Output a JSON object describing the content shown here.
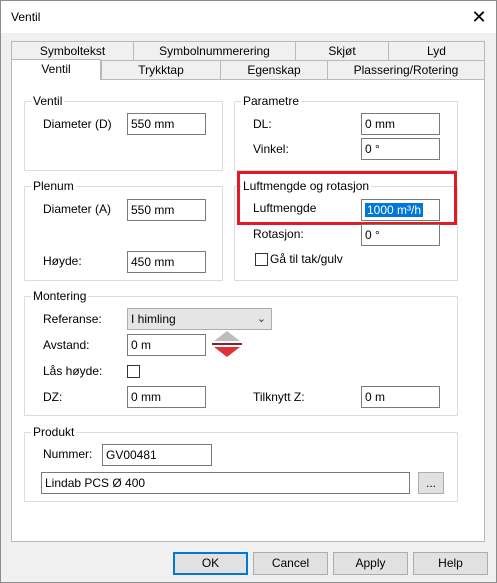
{
  "window": {
    "title": "Ventil",
    "close_glyph": "✕"
  },
  "tabs_row1": [
    "Symboltekst",
    "Symbolnummerering",
    "Skjøt",
    "Lyd"
  ],
  "tabs_row2": [
    "Ventil",
    "Trykktap",
    "Egenskap",
    "Plassering/Rotering"
  ],
  "active_tab": "Ventil",
  "ventil": {
    "title": "Ventil",
    "diameter_label": "Diameter (D)",
    "diameter_value": "550 mm"
  },
  "parametre": {
    "title": "Parametre",
    "dl_label": "DL:",
    "dl_value": "0 mm",
    "vinkel_label": "Vinkel:",
    "vinkel_value": "0 °"
  },
  "luft": {
    "title": "Luftmengde og rotasjon",
    "luftmengde_label": "Luftmengde",
    "luftmengde_value": "1000 m³/h",
    "rotasjon_label": "Rotasjon:",
    "rotasjon_value": "0 °",
    "gaa_til_label": "Gå til tak/gulv",
    "gaa_til_checked": false,
    "highlight_color": "#e01b24"
  },
  "plenum": {
    "title": "Plenum",
    "diameter_label": "Diameter (A)",
    "diameter_value": "550 mm",
    "hoyde_label": "Høyde:",
    "hoyde_value": "450 mm"
  },
  "montering": {
    "title": "Montering",
    "referanse_label": "Referanse:",
    "referanse_value": "I himling",
    "avstand_label": "Avstand:",
    "avstand_value": "0 m",
    "laas_label": "Lås høyde:",
    "laas_checked": false,
    "dz_label": "DZ:",
    "dz_value": "0 mm",
    "tilknytt_label": "Tilknytt Z:",
    "tilknytt_value": "0 m",
    "pick_icon": "up-down-arrows-icon"
  },
  "produkt": {
    "title": "Produkt",
    "nummer_label": "Nummer:",
    "nummer_value": "GV00481",
    "beskrivelse_value": "Lindab PCS Ø 400",
    "browse_label": "..."
  },
  "buttons": {
    "ok": "OK",
    "cancel": "Cancel",
    "apply": "Apply",
    "help": "Help"
  }
}
